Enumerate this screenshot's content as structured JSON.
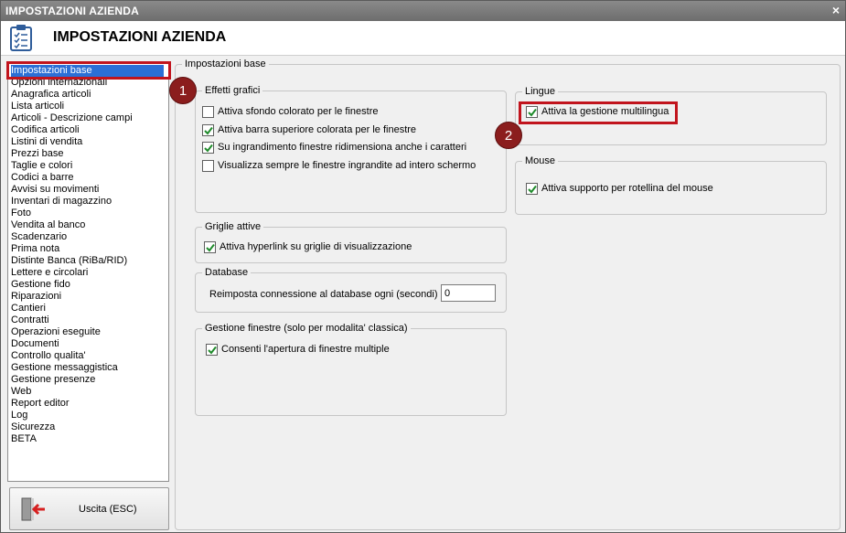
{
  "window": {
    "title": "IMPOSTAZIONI AZIENDA",
    "close_glyph": "×"
  },
  "header": {
    "title": "IMPOSTAZIONI AZIENDA",
    "icon": "clipboard-checklist-icon"
  },
  "nav": {
    "selected_index": 0,
    "items": [
      "Impostazioni base",
      "Opzioni internazionali",
      "Anagrafica articoli",
      "Lista articoli",
      "Articoli - Descrizione campi",
      "Codifica articoli",
      "Listini di vendita",
      "Prezzi base",
      "Taglie e colori",
      "Codici a barre",
      "Avvisi su movimenti",
      "Inventari di magazzino",
      "Foto",
      "Vendita al banco",
      "Scadenzario",
      "Prima nota",
      "Distinte Banca (RiBa/RID)",
      "Lettere e circolari",
      "Gestione fido",
      "Riparazioni",
      "Cantieri",
      "Contratti",
      "Operazioni eseguite",
      "Documenti",
      "Controllo qualita'",
      "Gestione messaggistica",
      "Gestione presenze",
      "Web",
      "Report editor",
      "Log",
      "Sicurezza",
      "BETA"
    ]
  },
  "exit_button": {
    "label": "Uscita (ESC)",
    "icon": "exit-door-icon"
  },
  "main": {
    "title": "Impostazioni base",
    "effetti": {
      "title": "Effetti grafici",
      "options": [
        {
          "label": "Attiva sfondo colorato per le finestre",
          "checked": false
        },
        {
          "label": "Attiva barra superiore colorata per le finestre",
          "checked": true
        },
        {
          "label": "Su ingrandimento finestre ridimensiona anche i caratteri",
          "checked": true
        },
        {
          "label": "Visualizza sempre le finestre ingrandite ad intero schermo",
          "checked": false
        }
      ]
    },
    "griglie": {
      "title": "Griglie attive",
      "option": {
        "label": "Attiva hyperlink su griglie di visualizzazione",
        "checked": true
      }
    },
    "database": {
      "title": "Database",
      "label": "Reimposta connessione al database ogni (secondi) :",
      "value": "0"
    },
    "gestione": {
      "title": "Gestione finestre (solo per modalita' classica)",
      "option": {
        "label": "Consenti l'apertura di finestre multiple",
        "checked": true
      }
    },
    "lingue": {
      "title": "Lingue",
      "option": {
        "label": "Attiva la gestione multilingua",
        "checked": true
      }
    },
    "mouse": {
      "title": "Mouse",
      "option": {
        "label": "Attiva supporto per rotellina del mouse",
        "checked": true
      }
    }
  },
  "annotations": {
    "badge1": "1",
    "badge2": "2",
    "highlight_color": "#c1141d",
    "badge_color": "#8b1d1d"
  }
}
